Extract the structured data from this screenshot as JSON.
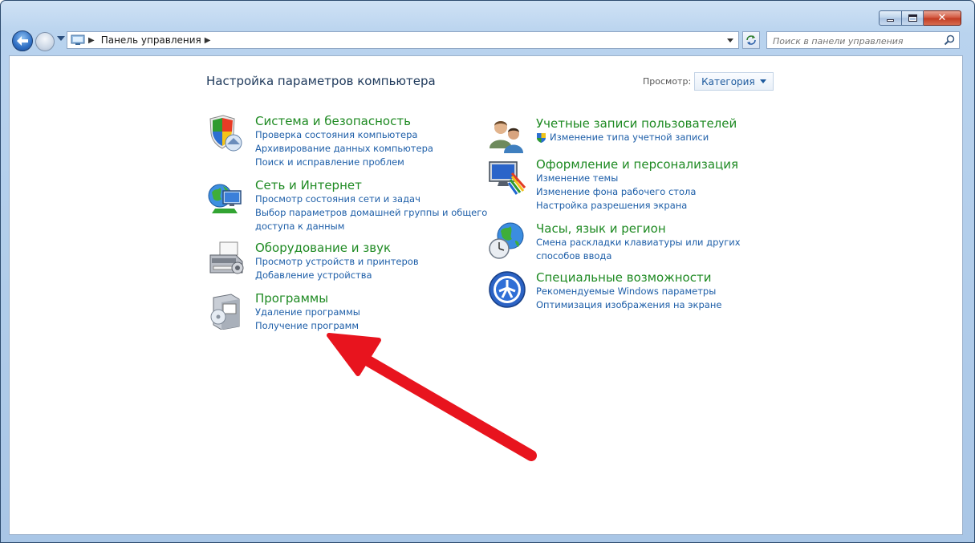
{
  "address_bar": {
    "breadcrumb": "Панель управления"
  },
  "search": {
    "placeholder": "Поиск в панели управления"
  },
  "page": {
    "title": "Настройка параметров компьютера",
    "view_by_label": "Просмотр:",
    "view_by_value": "Категория"
  },
  "left_categories": [
    {
      "title": "Система и безопасность",
      "icon": "shield-icon",
      "links": [
        "Проверка состояния компьютера",
        "Архивирование данных компьютера",
        "Поиск и исправление проблем"
      ]
    },
    {
      "title": "Сеть и Интернет",
      "icon": "network-globe-icon",
      "links": [
        "Просмотр состояния сети и задач",
        "Выбор параметров домашней группы и общего",
        "доступа к данным"
      ]
    },
    {
      "title": "Оборудование и звук",
      "icon": "printer-icon",
      "links": [
        "Просмотр устройств и принтеров",
        "Добавление устройства"
      ]
    },
    {
      "title": "Программы",
      "icon": "programs-box-icon",
      "links": [
        "Удаление программы",
        "Получение программ"
      ]
    }
  ],
  "right_categories": [
    {
      "title": "Учетные записи пользователей",
      "icon": "users-icon",
      "links": [
        "Изменение типа учетной записи"
      ]
    },
    {
      "title": "Оформление и персонализация",
      "icon": "display-paint-icon",
      "links": [
        "Изменение темы",
        "Изменение фона рабочего стола",
        "Настройка разрешения экрана"
      ]
    },
    {
      "title": "Часы, язык и регион",
      "icon": "clock-globe-icon",
      "links": [
        "Смена раскладки клавиатуры или других",
        "способов ввода"
      ]
    },
    {
      "title": "Специальные возможности",
      "icon": "accessibility-icon",
      "links": [
        "Рекомендуемые Windows параметры",
        "Оптимизация изображения на экране"
      ]
    }
  ],
  "colors": {
    "category_title": "#1e8a22",
    "link": "#1d5ea8",
    "annotation_arrow": "#e8141e"
  }
}
